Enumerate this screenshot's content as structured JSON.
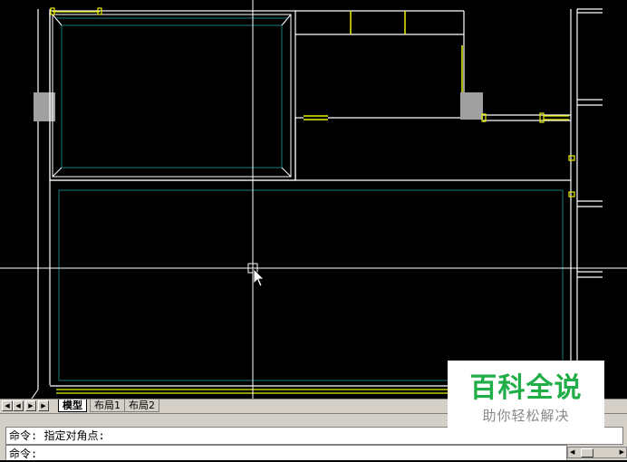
{
  "layout_tabs": [
    {
      "label": "模型",
      "active": true
    },
    {
      "label": "布局1",
      "active": false
    },
    {
      "label": "布局2",
      "active": false
    }
  ],
  "nav_buttons": [
    "first-tab",
    "previous-tab",
    "next-tab",
    "last-tab"
  ],
  "command": {
    "history_line": "命令: 指定对角点:",
    "prompt_line": "命令:"
  },
  "watermark": {
    "title": "百科全说",
    "subtitle": "助你轻松解决"
  },
  "colors": {
    "background": "#000000",
    "wall": "#ffffff",
    "inner_outline": "#1a7a7a",
    "window": "#e8f000",
    "column": "#a0a0a0",
    "watermark_green": "#1fae47"
  }
}
